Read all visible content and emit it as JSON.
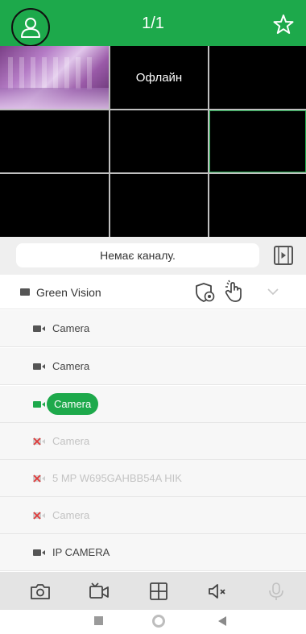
{
  "header": {
    "title": "1/1",
    "icons": {
      "user": "user-icon",
      "favorite": "star-icon"
    },
    "accent": "#1da94b"
  },
  "grid": {
    "offline_text": "Офлайн"
  },
  "search": {
    "no_channel_text": "Немає каналу.",
    "playback_icon": "playback-icon"
  },
  "device": {
    "name": "Green Vision",
    "icons": [
      "shield-settings-icon",
      "hand-pointer-icon",
      "chevron-down-icon"
    ]
  },
  "channels": [
    {
      "label": "Camera",
      "state": "online"
    },
    {
      "label": "Camera",
      "state": "online"
    },
    {
      "label": "Camera",
      "state": "selected"
    },
    {
      "label": "Camera",
      "state": "offline"
    },
    {
      "label": "5 MP W695GAHBB54A HIK",
      "state": "offline"
    },
    {
      "label": "Camera",
      "state": "offline"
    },
    {
      "label": "IP CAMERA",
      "state": "online"
    }
  ],
  "toolbar": {
    "icons": [
      "snapshot-icon",
      "record-icon",
      "layout-grid-icon",
      "mute-icon",
      "microphone-icon"
    ]
  },
  "navbar": {
    "icons": [
      "recents-icon",
      "home-icon",
      "back-icon"
    ]
  }
}
